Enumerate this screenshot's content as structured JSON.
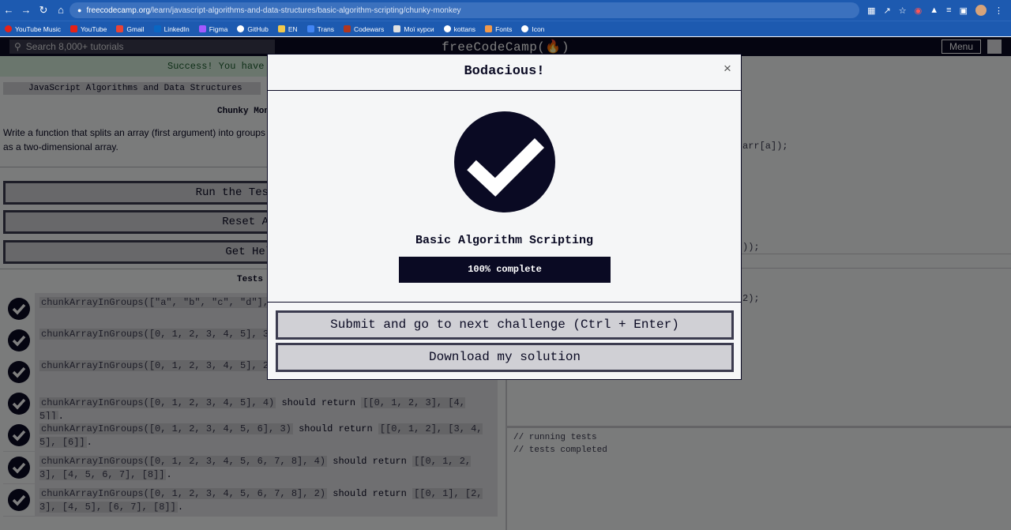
{
  "browser": {
    "url_host": "freecodecamp.org",
    "url_path": "/learn/javascript-algorithms-and-data-structures/basic-algorithm-scripting/chunky-monkey",
    "bookmarks": [
      "YouTube Music",
      "YouTube",
      "Gmail",
      "LinkedIn",
      "Figma",
      "GitHub",
      "EN",
      "Trans",
      "Codewars",
      "Мої курси",
      "kottans",
      "Fonts",
      "Icon"
    ]
  },
  "navbar": {
    "search_placeholder": "Search 8,000+ tutorials",
    "brand": "freeCodeCamp(🔥)",
    "menu_label": "Menu"
  },
  "page": {
    "success_text": "Success! You have",
    "breadcrumb": "JavaScript Algorithms and Data Structures",
    "challenge_title": "Chunky Mon",
    "description": "Write a function that splits an array (first argument) into groups as a two-dimensional array.",
    "run_tests": "Run the Tests (Ct",
    "reset_all": "Reset All",
    "get_help": "Get Help",
    "tests_heading": "Tests",
    "tests": [
      {
        "code": "chunkArrayInGroups([\"a\", \"b\", \"c\", \"d\"], 2)",
        "text": "",
        "result": ""
      },
      {
        "code": "chunkArrayInGroups([0, 1, 2, 3, 4, 5], 3)",
        "text": "s",
        "result": ""
      },
      {
        "code": "chunkArrayInGroups([0, 1, 2, 3, 4, 5], 2)",
        "text": "s",
        "result": ""
      },
      {
        "code": "chunkArrayInGroups([0, 1, 2, 3, 4, 5], 4)",
        "text": "should return",
        "result": "[[0, 1, 2, 3], [4, 5]]",
        "tail": "."
      },
      {
        "code": "chunkArrayInGroups([0, 1, 2, 3, 4, 5, 6], 3)",
        "text": "should return",
        "result": "[[0, 1, 2], [3, 4, 5], [6]]",
        "tail": "."
      },
      {
        "code": "chunkArrayInGroups([0, 1, 2, 3, 4, 5, 6, 7, 8], 4)",
        "text": "should return",
        "result": "[[0, 1, 2, 3], [4, 5, 6, 7], [8]]",
        "tail": "."
      },
      {
        "code": "chunkArrayInGroups([0, 1, 2, 3, 4, 5, 6, 7, 8], 2)",
        "text": "should return",
        "result": "[[0, 1], [2, 3], [4, 5], [6, 7], [8]]",
        "tail": "."
      }
    ],
    "editor_lines": [
      "arr[a]);",
      "));",
      "2);"
    ],
    "console_lines": [
      "// running tests",
      "// tests completed"
    ]
  },
  "modal": {
    "title": "Bodacious!",
    "close": "×",
    "certification": "Basic Algorithm Scripting",
    "progress_percent": 100,
    "progress_label": "100% complete",
    "submit_button": "Submit and go to next challenge (Ctrl + Enter)",
    "download_button": "Download my solution"
  }
}
